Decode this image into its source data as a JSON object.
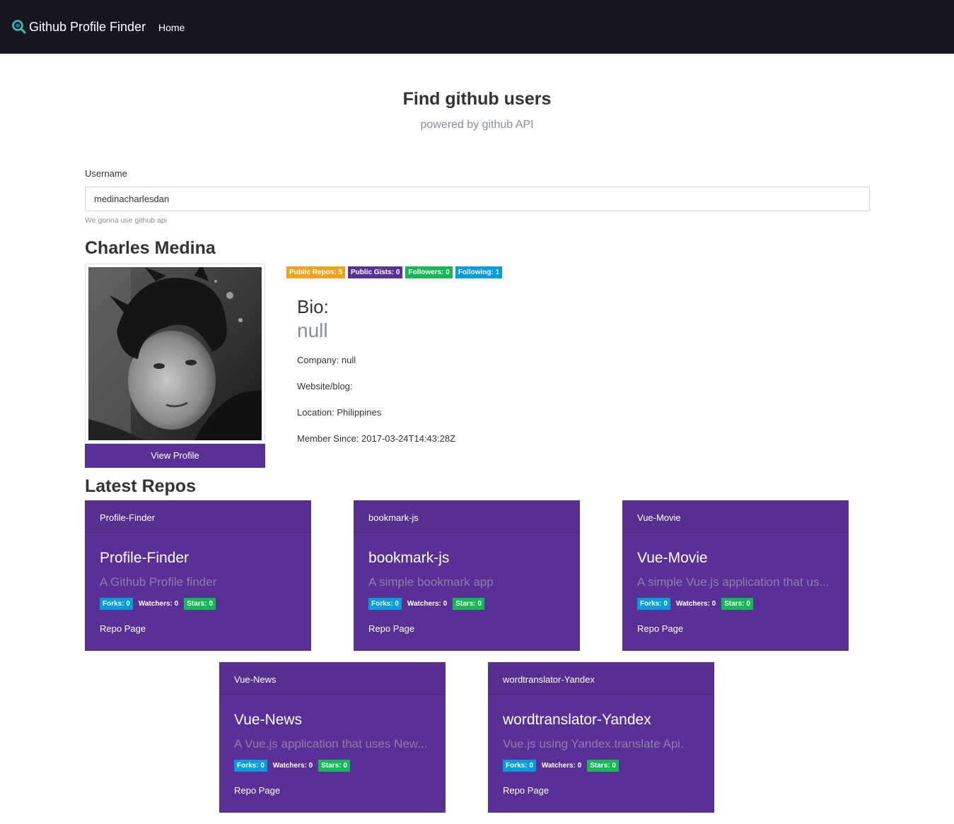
{
  "nav": {
    "brand": "Github Profile Finder",
    "brand_icon": "search-icon",
    "home": "Home"
  },
  "header": {
    "title": "Find github users",
    "subtitle": "powered by github API"
  },
  "search": {
    "label": "Username",
    "value": "medinacharlesdan",
    "help": "We gonna use github api"
  },
  "profile": {
    "name": "Charles Medina",
    "view_profile": "View Profile",
    "badges": {
      "public_repos": "Public Repos: 5",
      "public_gists": "Public Gists: 0",
      "followers": "Followers: 0",
      "following": "Following: 1"
    },
    "bio_label": "Bio:",
    "bio_value": "null",
    "company": "Company: null",
    "website": "Website/blog:",
    "location": "Location: Philippines",
    "member_since": "Member Since: 2017-03-24T14:43:28Z"
  },
  "repos": {
    "title": "Latest Repos",
    "link_label": "Repo Page",
    "items": [
      {
        "header": "Profile-Finder",
        "name": "Profile-Finder",
        "description": "A Github Profile finder",
        "forks": "Forks: 0",
        "watchers": "Watchers: 0",
        "stars": "Stars: 0"
      },
      {
        "header": "bookmark-js",
        "name": "bookmark-js",
        "description": "A simple bookmark app",
        "forks": "Forks: 0",
        "watchers": "Watchers: 0",
        "stars": "Stars: 0"
      },
      {
        "header": "Vue-Movie",
        "name": "Vue-Movie",
        "description": "A simple Vue.js application that us...",
        "forks": "Forks: 0",
        "watchers": "Watchers: 0",
        "stars": "Stars: 0"
      },
      {
        "header": "Vue-News",
        "name": "Vue-News",
        "description": "A Vue.js application that uses New...",
        "forks": "Forks: 0",
        "watchers": "Watchers: 0",
        "stars": "Stars: 0"
      },
      {
        "header": "wordtranslator-Yandex",
        "name": "wordtranslator-Yandex",
        "description": "Vue.js using Yandex.translate Api.",
        "forks": "Forks: 0",
        "watchers": "Watchers: 0",
        "stars": "Stars: 0"
      }
    ]
  },
  "colors": {
    "navbar": "#1a1621",
    "primary": "#593196",
    "warning": "#efa31d",
    "success": "#13b955",
    "info": "#009cdc"
  }
}
